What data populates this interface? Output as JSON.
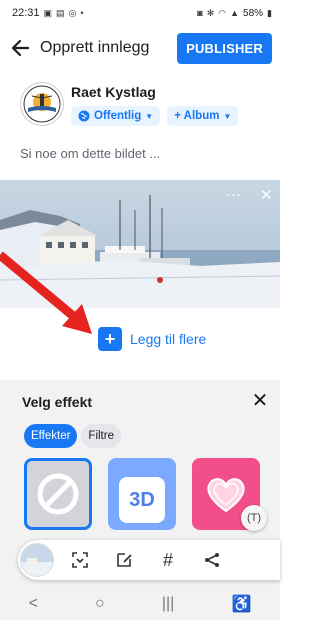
{
  "status_bar": {
    "time": "22:31",
    "battery": "58%"
  },
  "header": {
    "title": "Opprett innlegg",
    "publish_label": "PUBLISHER"
  },
  "profile": {
    "name": "Raet Kystlag",
    "privacy_label": "Offentlig",
    "album_label": "+ Album"
  },
  "composer": {
    "placeholder": "Si noe om dette bildet ..."
  },
  "photo": {
    "more_label": "···",
    "close_label": "✕"
  },
  "add_more": {
    "label": "Legg til flere"
  },
  "effects": {
    "title": "Velg effekt",
    "tabs": [
      {
        "label": "Effekter",
        "active": true
      },
      {
        "label": "Filtre",
        "active": false
      }
    ],
    "tile_3d_label": "3D"
  },
  "toolbar": {
    "hashtag_label": "#"
  },
  "nav": {
    "back": "<",
    "home": "○",
    "recents": "|||",
    "accessibility": "♿"
  },
  "colors": {
    "accent": "#1877f2",
    "arrow": "#e5231f"
  }
}
